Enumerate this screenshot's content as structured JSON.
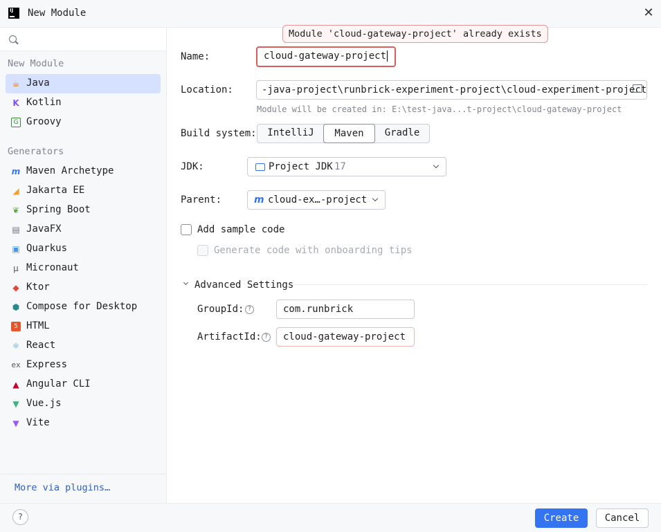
{
  "window": {
    "title": "New Module",
    "logo_text": "IJ"
  },
  "sidebar": {
    "search_placeholder": "",
    "section_new": "New Module",
    "new_items": [
      {
        "label": "Java",
        "icon": "java-icon",
        "selected": true
      },
      {
        "label": "Kotlin",
        "icon": "kotlin-icon"
      },
      {
        "label": "Groovy",
        "icon": "groovy-icon"
      }
    ],
    "section_generators": "Generators",
    "generators": [
      {
        "label": "Maven Archetype",
        "icon": "maven-icon"
      },
      {
        "label": "Jakarta EE",
        "icon": "jakarta-icon"
      },
      {
        "label": "Spring Boot",
        "icon": "spring-icon"
      },
      {
        "label": "JavaFX",
        "icon": "javafx-icon"
      },
      {
        "label": "Quarkus",
        "icon": "quarkus-icon"
      },
      {
        "label": "Micronaut",
        "icon": "micronaut-icon"
      },
      {
        "label": "Ktor",
        "icon": "ktor-icon"
      },
      {
        "label": "Compose for Desktop",
        "icon": "compose-icon"
      },
      {
        "label": "HTML",
        "icon": "html-icon"
      },
      {
        "label": "React",
        "icon": "react-icon"
      },
      {
        "label": "Express",
        "icon": "express-icon"
      },
      {
        "label": "Angular CLI",
        "icon": "angular-icon"
      },
      {
        "label": "Vue.js",
        "icon": "vue-icon"
      },
      {
        "label": "Vite",
        "icon": "vite-icon"
      }
    ],
    "more_plugins": "More via plugins…"
  },
  "form": {
    "error_tooltip": "Module 'cloud-gateway-project' already exists",
    "name_label": "Name:",
    "name_value": "cloud-gateway-project",
    "location_label": "Location:",
    "location_value": "-java-project\\runbrick-experiment-project\\cloud-experiment-project",
    "location_hint": "Module will be created in: E:\\test-java...t-project\\cloud-gateway-project",
    "build_label": "Build system:",
    "build_options": [
      "IntelliJ",
      "Maven",
      "Gradle"
    ],
    "build_selected": "Maven",
    "jdk_label": "JDK:",
    "jdk_value": "Project JDK",
    "jdk_version": "17",
    "parent_label": "Parent:",
    "parent_value": "cloud-ex…-project",
    "sample_code_label": "Add sample code",
    "onboarding_label": "Generate code with onboarding tips",
    "advanced_label": "Advanced Settings",
    "group_label": "GroupId:",
    "group_value": "com.runbrick",
    "artifact_label": "ArtifactId:",
    "artifact_value": "cloud-gateway-project"
  },
  "footer": {
    "help": "?",
    "create": "Create",
    "cancel": "Cancel"
  },
  "colors": {
    "accent": "#3574f0",
    "error_border": "#db5c5c",
    "selection": "#d5e1ff"
  }
}
